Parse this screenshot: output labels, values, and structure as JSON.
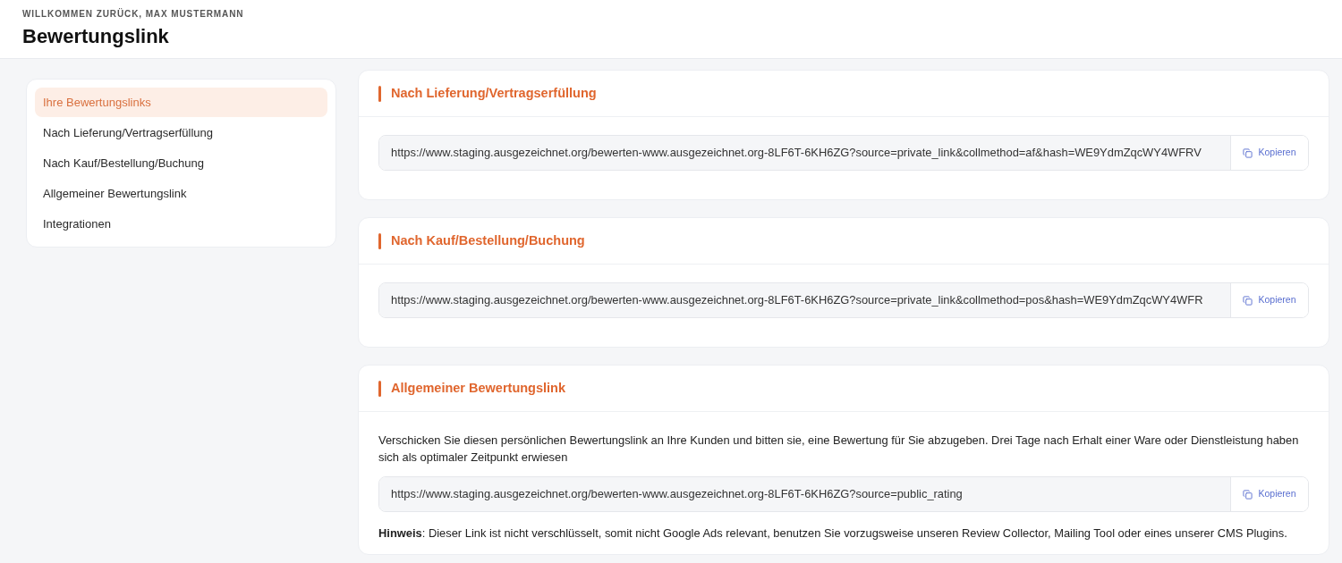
{
  "header": {
    "greeting": "WILLKOMMEN ZURÜCK, MAX MUSTERMANN",
    "title": "Bewertungslink"
  },
  "sidebar": {
    "items": [
      {
        "label": "Ihre Bewertungslinks",
        "selected": true
      },
      {
        "label": "Nach Lieferung/Vertragserfüllung",
        "selected": false
      },
      {
        "label": "Nach Kauf/Bestellung/Buchung",
        "selected": false
      },
      {
        "label": "Allgemeiner Bewertungslink",
        "selected": false
      },
      {
        "label": "Integrationen",
        "selected": false
      }
    ]
  },
  "cards": [
    {
      "title": "Nach Lieferung/Vertragserfüllung",
      "link": "https://www.staging.ausgezeichnet.org/bewerten-www.ausgezeichnet.org-8LF6T-6KH6ZG?source=private_link&collmethod=af&hash=WE9YdmZqcWY4WFRV",
      "copy_label": "Kopieren"
    },
    {
      "title": "Nach Kauf/Bestellung/Buchung",
      "link": "https://www.staging.ausgezeichnet.org/bewerten-www.ausgezeichnet.org-8LF6T-6KH6ZG?source=private_link&collmethod=pos&hash=WE9YdmZqcWY4WFR",
      "copy_label": "Kopieren"
    },
    {
      "title": "Allgemeiner Bewertungslink",
      "description": "Verschicken Sie diesen persönlichen Bewertungslink an Ihre Kunden und bitten sie, eine Bewertung für Sie abzugeben. Drei Tage nach Erhalt einer Ware oder Dienstleistung haben sich als optimaler Zeitpunkt erwiesen",
      "link": "https://www.staging.ausgezeichnet.org/bewerten-www.ausgezeichnet.org-8LF6T-6KH6ZG?source=public_rating",
      "copy_label": "Kopieren",
      "note": "**Hinweis**: Dieser Link ist nicht verschlüsselt, somit nicht Google Ads relevant, benutzen Sie vorzugsweise unseren Review Collector, Mailing Tool oder eines unserer CMS Plugins."
    }
  ]
}
